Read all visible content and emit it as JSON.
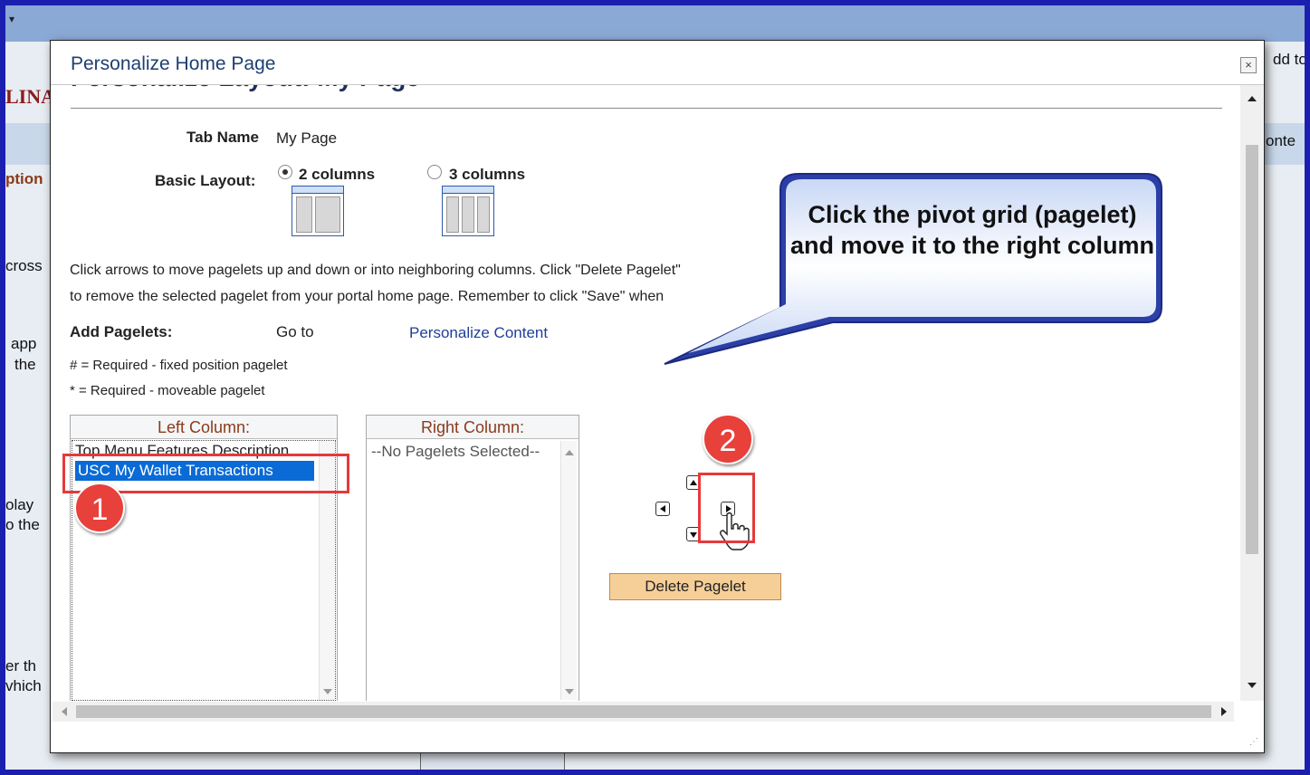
{
  "background": {
    "brand_fragment": "LINA",
    "options_fragment": "ption",
    "right_fragment_1": "dd to",
    "right_fragment_2": "onte",
    "fragment_across": "cross",
    "fragment_app": "app",
    "fragment_the": "the",
    "fragment_play": "olay",
    "fragment_to_the": "o the",
    "fragment_er_th": "er th",
    "fragment_which": "vhich"
  },
  "modal": {
    "title": "Personalize Home Page",
    "close_label": "×",
    "heading": "Personalize Layout: My Page"
  },
  "form": {
    "tab_name_label": "Tab Name",
    "tab_name_value": "My Page",
    "basic_layout_label": "Basic Layout:",
    "layout_options": [
      {
        "label": "2 columns",
        "checked": true
      },
      {
        "label": "3 columns",
        "checked": false
      }
    ],
    "help_line_1": "Click arrows to move pagelets up and down or into neighboring columns. Click \"Delete Pagelet\"",
    "help_line_2": "to remove the selected pagelet from your portal home page. Remember to click \"Save\" when",
    "add_pagelets_label": "Add Pagelets:",
    "go_to_label": "Go to",
    "personalize_content_link": "Personalize Content",
    "required_fixed_note": "# = Required - fixed position pagelet",
    "required_movable_note": "* = Required - moveable pagelet"
  },
  "left_column": {
    "header": "Left Column:",
    "items": [
      {
        "label": "Top Menu Features Description",
        "selected": false
      },
      {
        "label": "USC My Wallet Transactions",
        "selected": true
      }
    ]
  },
  "right_column": {
    "header": "Right Column:",
    "items": [
      {
        "label": "--No Pagelets Selected--",
        "selected": false
      }
    ]
  },
  "controls": {
    "delete_label": "Delete Pagelet"
  },
  "annotations": {
    "marker_1": "1",
    "marker_2": "2",
    "callout_text": "Click the pivot grid (pagelet) and move it to the right column",
    "highlight_color": "#e53a3a",
    "callout_fill": "#2c3fa8"
  }
}
